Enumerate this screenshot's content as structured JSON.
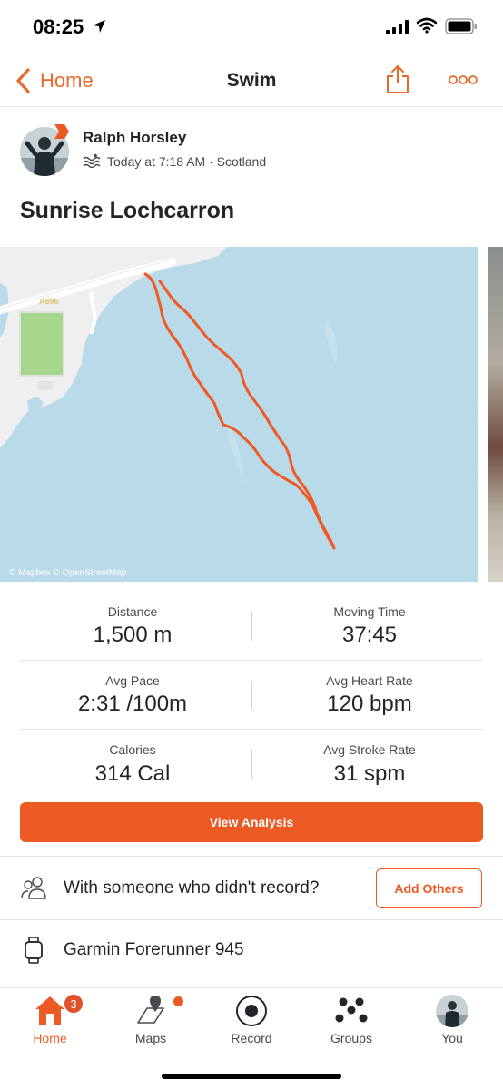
{
  "status_bar": {
    "time": "08:25"
  },
  "nav": {
    "back_label": "Home",
    "title": "Swim"
  },
  "athlete": {
    "name": "Ralph Horsley",
    "meta": "Today at 7:18 AM · Scotland"
  },
  "activity": {
    "title": "Sunrise Lochcarron"
  },
  "map": {
    "attribution": "© Mapbox © OpenStreetMap",
    "road_label": "A896"
  },
  "stats": [
    {
      "label": "Distance",
      "value": "1,500 m"
    },
    {
      "label": "Moving Time",
      "value": "37:45"
    },
    {
      "label": "Avg Pace",
      "value": "2:31 /100m"
    },
    {
      "label": "Avg Heart Rate",
      "value": "120 bpm"
    },
    {
      "label": "Calories",
      "value": "314 Cal"
    },
    {
      "label": "Avg Stroke Rate",
      "value": "31 spm"
    }
  ],
  "buttons": {
    "view_analysis": "View Analysis",
    "add_others": "Add Others"
  },
  "with_someone": "With someone who didn't record?",
  "device": "Garmin Forerunner 945",
  "tabs": [
    {
      "label": "Home",
      "badge": "3",
      "active": true
    },
    {
      "label": "Maps",
      "dot": true
    },
    {
      "label": "Record"
    },
    {
      "label": "Groups"
    },
    {
      "label": "You"
    }
  ],
  "colors": {
    "accent": "#ec5a24",
    "text": "#242428",
    "water": "#b9dbe9",
    "route": "#f05a22"
  }
}
